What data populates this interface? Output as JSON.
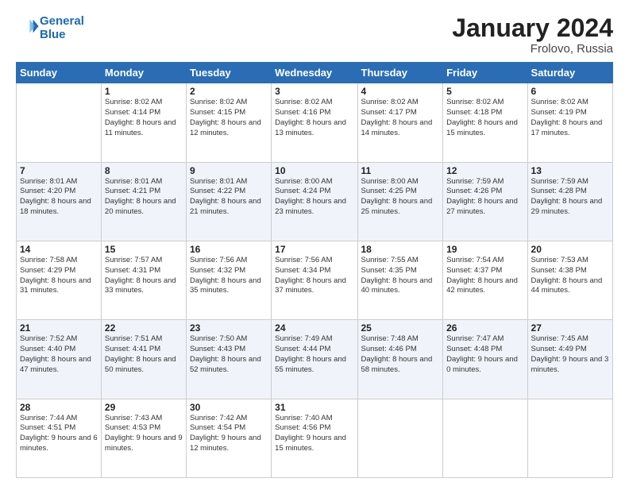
{
  "header": {
    "logo_line1": "General",
    "logo_line2": "Blue",
    "title": "January 2024",
    "subtitle": "Frolovo, Russia"
  },
  "days_of_week": [
    "Sunday",
    "Monday",
    "Tuesday",
    "Wednesday",
    "Thursday",
    "Friday",
    "Saturday"
  ],
  "weeks": [
    [
      {
        "day": "",
        "sunrise": "",
        "sunset": "",
        "daylight": ""
      },
      {
        "day": "1",
        "sunrise": "Sunrise: 8:02 AM",
        "sunset": "Sunset: 4:14 PM",
        "daylight": "Daylight: 8 hours and 11 minutes."
      },
      {
        "day": "2",
        "sunrise": "Sunrise: 8:02 AM",
        "sunset": "Sunset: 4:15 PM",
        "daylight": "Daylight: 8 hours and 12 minutes."
      },
      {
        "day": "3",
        "sunrise": "Sunrise: 8:02 AM",
        "sunset": "Sunset: 4:16 PM",
        "daylight": "Daylight: 8 hours and 13 minutes."
      },
      {
        "day": "4",
        "sunrise": "Sunrise: 8:02 AM",
        "sunset": "Sunset: 4:17 PM",
        "daylight": "Daylight: 8 hours and 14 minutes."
      },
      {
        "day": "5",
        "sunrise": "Sunrise: 8:02 AM",
        "sunset": "Sunset: 4:18 PM",
        "daylight": "Daylight: 8 hours and 15 minutes."
      },
      {
        "day": "6",
        "sunrise": "Sunrise: 8:02 AM",
        "sunset": "Sunset: 4:19 PM",
        "daylight": "Daylight: 8 hours and 17 minutes."
      }
    ],
    [
      {
        "day": "7",
        "sunrise": "Sunrise: 8:01 AM",
        "sunset": "Sunset: 4:20 PM",
        "daylight": "Daylight: 8 hours and 18 minutes."
      },
      {
        "day": "8",
        "sunrise": "Sunrise: 8:01 AM",
        "sunset": "Sunset: 4:21 PM",
        "daylight": "Daylight: 8 hours and 20 minutes."
      },
      {
        "day": "9",
        "sunrise": "Sunrise: 8:01 AM",
        "sunset": "Sunset: 4:22 PM",
        "daylight": "Daylight: 8 hours and 21 minutes."
      },
      {
        "day": "10",
        "sunrise": "Sunrise: 8:00 AM",
        "sunset": "Sunset: 4:24 PM",
        "daylight": "Daylight: 8 hours and 23 minutes."
      },
      {
        "day": "11",
        "sunrise": "Sunrise: 8:00 AM",
        "sunset": "Sunset: 4:25 PM",
        "daylight": "Daylight: 8 hours and 25 minutes."
      },
      {
        "day": "12",
        "sunrise": "Sunrise: 7:59 AM",
        "sunset": "Sunset: 4:26 PM",
        "daylight": "Daylight: 8 hours and 27 minutes."
      },
      {
        "day": "13",
        "sunrise": "Sunrise: 7:59 AM",
        "sunset": "Sunset: 4:28 PM",
        "daylight": "Daylight: 8 hours and 29 minutes."
      }
    ],
    [
      {
        "day": "14",
        "sunrise": "Sunrise: 7:58 AM",
        "sunset": "Sunset: 4:29 PM",
        "daylight": "Daylight: 8 hours and 31 minutes."
      },
      {
        "day": "15",
        "sunrise": "Sunrise: 7:57 AM",
        "sunset": "Sunset: 4:31 PM",
        "daylight": "Daylight: 8 hours and 33 minutes."
      },
      {
        "day": "16",
        "sunrise": "Sunrise: 7:56 AM",
        "sunset": "Sunset: 4:32 PM",
        "daylight": "Daylight: 8 hours and 35 minutes."
      },
      {
        "day": "17",
        "sunrise": "Sunrise: 7:56 AM",
        "sunset": "Sunset: 4:34 PM",
        "daylight": "Daylight: 8 hours and 37 minutes."
      },
      {
        "day": "18",
        "sunrise": "Sunrise: 7:55 AM",
        "sunset": "Sunset: 4:35 PM",
        "daylight": "Daylight: 8 hours and 40 minutes."
      },
      {
        "day": "19",
        "sunrise": "Sunrise: 7:54 AM",
        "sunset": "Sunset: 4:37 PM",
        "daylight": "Daylight: 8 hours and 42 minutes."
      },
      {
        "day": "20",
        "sunrise": "Sunrise: 7:53 AM",
        "sunset": "Sunset: 4:38 PM",
        "daylight": "Daylight: 8 hours and 44 minutes."
      }
    ],
    [
      {
        "day": "21",
        "sunrise": "Sunrise: 7:52 AM",
        "sunset": "Sunset: 4:40 PM",
        "daylight": "Daylight: 8 hours and 47 minutes."
      },
      {
        "day": "22",
        "sunrise": "Sunrise: 7:51 AM",
        "sunset": "Sunset: 4:41 PM",
        "daylight": "Daylight: 8 hours and 50 minutes."
      },
      {
        "day": "23",
        "sunrise": "Sunrise: 7:50 AM",
        "sunset": "Sunset: 4:43 PM",
        "daylight": "Daylight: 8 hours and 52 minutes."
      },
      {
        "day": "24",
        "sunrise": "Sunrise: 7:49 AM",
        "sunset": "Sunset: 4:44 PM",
        "daylight": "Daylight: 8 hours and 55 minutes."
      },
      {
        "day": "25",
        "sunrise": "Sunrise: 7:48 AM",
        "sunset": "Sunset: 4:46 PM",
        "daylight": "Daylight: 8 hours and 58 minutes."
      },
      {
        "day": "26",
        "sunrise": "Sunrise: 7:47 AM",
        "sunset": "Sunset: 4:48 PM",
        "daylight": "Daylight: 9 hours and 0 minutes."
      },
      {
        "day": "27",
        "sunrise": "Sunrise: 7:45 AM",
        "sunset": "Sunset: 4:49 PM",
        "daylight": "Daylight: 9 hours and 3 minutes."
      }
    ],
    [
      {
        "day": "28",
        "sunrise": "Sunrise: 7:44 AM",
        "sunset": "Sunset: 4:51 PM",
        "daylight": "Daylight: 9 hours and 6 minutes."
      },
      {
        "day": "29",
        "sunrise": "Sunrise: 7:43 AM",
        "sunset": "Sunset: 4:53 PM",
        "daylight": "Daylight: 9 hours and 9 minutes."
      },
      {
        "day": "30",
        "sunrise": "Sunrise: 7:42 AM",
        "sunset": "Sunset: 4:54 PM",
        "daylight": "Daylight: 9 hours and 12 minutes."
      },
      {
        "day": "31",
        "sunrise": "Sunrise: 7:40 AM",
        "sunset": "Sunset: 4:56 PM",
        "daylight": "Daylight: 9 hours and 15 minutes."
      },
      {
        "day": "",
        "sunrise": "",
        "sunset": "",
        "daylight": ""
      },
      {
        "day": "",
        "sunrise": "",
        "sunset": "",
        "daylight": ""
      },
      {
        "day": "",
        "sunrise": "",
        "sunset": "",
        "daylight": ""
      }
    ]
  ]
}
